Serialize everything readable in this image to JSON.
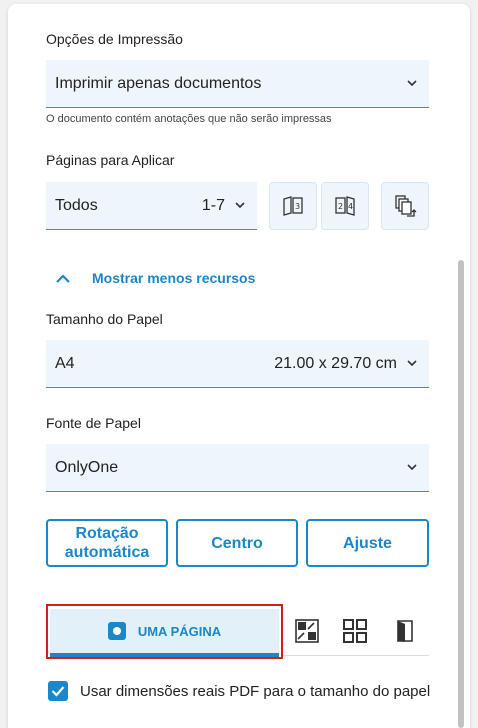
{
  "print_options": {
    "label": "Opções de Impressão",
    "value": "Imprimir apenas documentos",
    "hint": "O documento contém anotações que não serão impressas"
  },
  "pages": {
    "label": "Páginas para Aplicar",
    "value": "Todos",
    "range": "1-7",
    "buttons": [
      "odd-pages-icon",
      "even-pages-icon",
      "reverse-pages-icon"
    ]
  },
  "toggle": {
    "label": "Mostrar menos recursos"
  },
  "paper_size": {
    "label": "Tamanho do Papel",
    "value": "A4",
    "dimensions": "21.00 x 29.70 cm"
  },
  "paper_source": {
    "label": "Fonte de Papel",
    "value": "OnlyOne"
  },
  "orientation_buttons": {
    "auto_rotate": "Rotação automática",
    "center": "Centro",
    "fit": "Ajuste"
  },
  "layout": {
    "one_page": "UMA PÁGINA",
    "icons": [
      "booklet-icon",
      "multiple-pages-icon",
      "poster-icon"
    ]
  },
  "checkbox": {
    "label": "Usar dimensões reais PDF para o tamanho do papel",
    "checked": true
  },
  "colors": {
    "accent": "#1b87c9",
    "highlight": "#d71c1c",
    "field_bg": "#eef6fb"
  }
}
